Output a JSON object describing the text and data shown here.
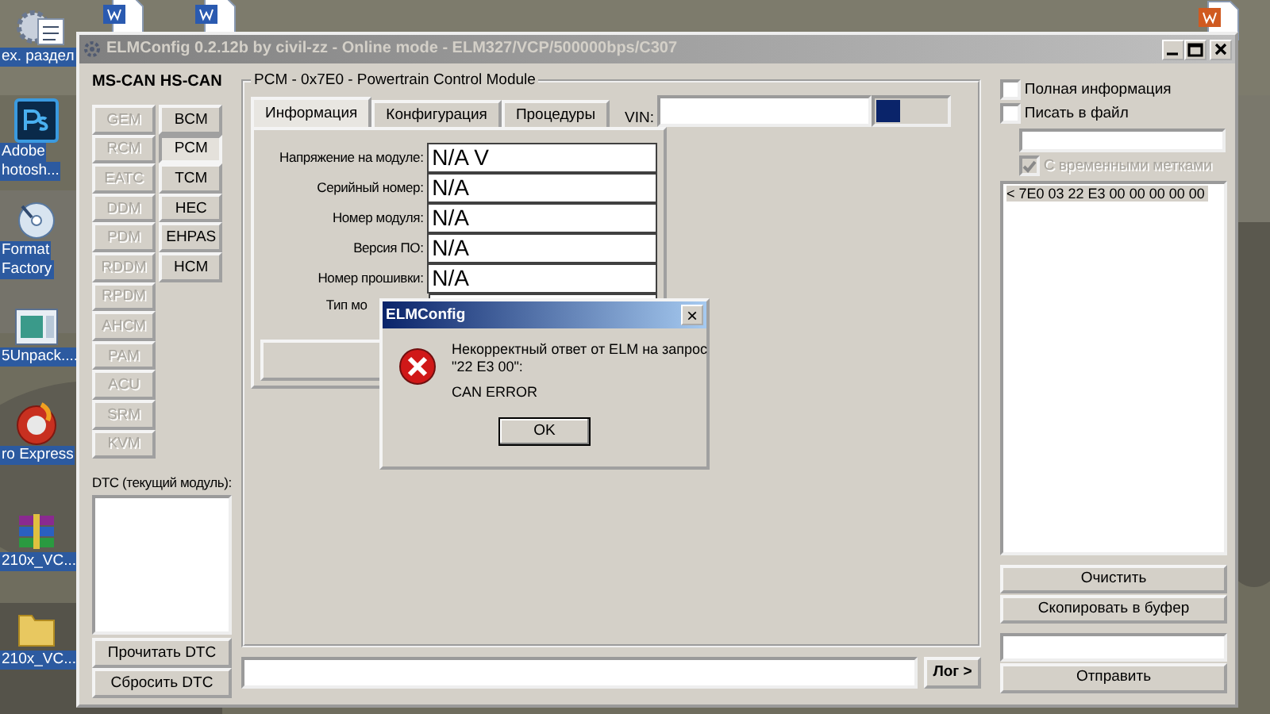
{
  "desktop": {
    "icons": [
      {
        "kind": "settings",
        "label": [
          "ех. раздел"
        ]
      },
      {
        "kind": "word"
      },
      {
        "kind": "word"
      },
      {
        "kind": "photoshop",
        "label": [
          "Adobe",
          "hotosh..."
        ]
      },
      {
        "kind": "disc",
        "label": [
          "Format",
          "Factory"
        ]
      },
      {
        "kind": "app",
        "label": [
          "5Unpack...."
        ]
      },
      {
        "kind": "burn",
        "label": [
          "ro Express"
        ]
      },
      {
        "kind": "archive",
        "label": [
          "210x_VC..."
        ]
      },
      {
        "kind": "folder",
        "label": [
          "210x_VC..."
        ]
      },
      {
        "kind": "powerpoint"
      }
    ]
  },
  "window": {
    "title": "ELMConfig 0.2.12b by civil-zz - Online mode - ELM327/VCP/500000bps/C307",
    "ms_can": {
      "label": "MS-CAN",
      "modules": [
        {
          "label": "GEM",
          "disabled": true,
          "selected": false
        },
        {
          "label": "RCM",
          "disabled": true,
          "selected": false
        },
        {
          "label": "EATC",
          "disabled": true,
          "selected": false
        },
        {
          "label": "DDM",
          "disabled": true,
          "selected": false
        },
        {
          "label": "PDM",
          "disabled": true,
          "selected": false
        },
        {
          "label": "RDDM",
          "disabled": true,
          "selected": false
        },
        {
          "label": "RPDM",
          "disabled": true,
          "selected": false
        },
        {
          "label": "AHCM",
          "disabled": true,
          "selected": false
        },
        {
          "label": "PAM",
          "disabled": true,
          "selected": false
        },
        {
          "label": "ACU",
          "disabled": true,
          "selected": false
        },
        {
          "label": "SRM",
          "disabled": true,
          "selected": false
        },
        {
          "label": "KVM",
          "disabled": true,
          "selected": false
        }
      ]
    },
    "hs_can": {
      "label": "HS-CAN",
      "modules": [
        {
          "label": "BCM",
          "disabled": false,
          "selected": false
        },
        {
          "label": "PCM",
          "disabled": false,
          "selected": true
        },
        {
          "label": "TCM",
          "disabled": false,
          "selected": false
        },
        {
          "label": "HEC",
          "disabled": false,
          "selected": false
        },
        {
          "label": "EHPAS",
          "disabled": false,
          "selected": false
        },
        {
          "label": "HCM",
          "disabled": false,
          "selected": false
        }
      ]
    },
    "dtc": {
      "label": "DTC (текущий модуль):",
      "buttons": [
        "Прочитать DTC",
        "Сбросить DTC"
      ]
    },
    "module": {
      "title": "PCM - 0x7E0 - Powertrain Control Module",
      "tabs": [
        {
          "label": "Информация",
          "selected": true
        },
        {
          "label": "Конфигурация",
          "selected": false
        },
        {
          "label": "Процедуры",
          "selected": false
        }
      ],
      "vin_label": "VIN:",
      "progress": {
        "level": 0.33
      },
      "fields": [
        {
          "label": "Напряжение на модуле:",
          "value": "N/A V"
        },
        {
          "label": "Серийный номер:",
          "value": "N/A"
        },
        {
          "label": "Номер модуля:",
          "value": "N/A"
        },
        {
          "label": "Версия ПО:",
          "value": "N/A"
        },
        {
          "label": "Номер прошивки:",
          "value": "N/A"
        },
        {
          "label": "Тип мо"
        }
      ]
    },
    "log_button": "Лог >",
    "options": [
      {
        "label": "Полная информация",
        "checked": false,
        "disabled": false
      },
      {
        "label": "Писать в файл",
        "checked": false,
        "disabled": false
      },
      {
        "label": "С временными метками",
        "checked": true,
        "disabled": true
      }
    ],
    "log_lines": [
      {
        "text": "< 7E0 03 22 E3 00 00 00 00 00",
        "selected": true
      }
    ],
    "log_buttons": [
      "Очистить",
      "Скопировать в буфер"
    ],
    "send_button": "Отправить"
  },
  "dialog": {
    "title": "ELMConfig",
    "close": "×",
    "message": [
      "Некорректный ответ от ELM на запрос",
      "\"22 E3 00\":"
    ],
    "detail": "CAN ERROR",
    "button": "OK"
  }
}
